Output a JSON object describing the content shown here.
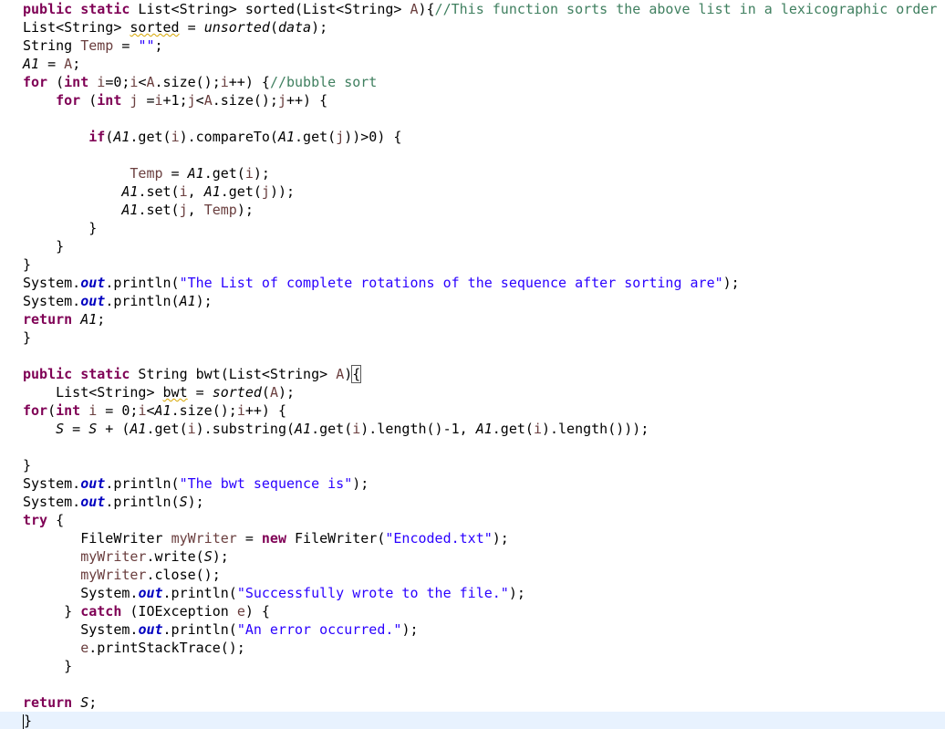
{
  "lines": [
    {
      "segments": [
        {
          "t": "public",
          "k": "kw"
        },
        {
          "t": " "
        },
        {
          "t": "static",
          "k": "kw"
        },
        {
          "t": " List<String> sorted(List<String> "
        },
        {
          "t": "A",
          "k": "lv"
        },
        {
          "t": "){"
        },
        {
          "t": "//This function sorts the above list in a lexicographic order",
          "k": "cm"
        }
      ]
    },
    {
      "segments": [
        {
          "t": "List<String> "
        },
        {
          "t": "sorted",
          "k": "warn"
        },
        {
          "t": " = "
        },
        {
          "t": "unsorted",
          "k": "it"
        },
        {
          "t": "("
        },
        {
          "t": "data",
          "k": "it"
        },
        {
          "t": ");"
        }
      ]
    },
    {
      "segments": [
        {
          "t": "String "
        },
        {
          "t": "Temp",
          "k": "lv"
        },
        {
          "t": " = "
        },
        {
          "t": "\"\"",
          "k": "st"
        },
        {
          "t": ";"
        }
      ]
    },
    {
      "segments": [
        {
          "t": "A1",
          "k": "it"
        },
        {
          "t": " = "
        },
        {
          "t": "A",
          "k": "lv"
        },
        {
          "t": ";"
        }
      ]
    },
    {
      "segments": [
        {
          "t": "for",
          "k": "kw"
        },
        {
          "t": " ("
        },
        {
          "t": "int",
          "k": "kw"
        },
        {
          "t": " "
        },
        {
          "t": "i",
          "k": "lv"
        },
        {
          "t": "=0;"
        },
        {
          "t": "i",
          "k": "lv"
        },
        {
          "t": "<"
        },
        {
          "t": "A",
          "k": "lv"
        },
        {
          "t": ".size();"
        },
        {
          "t": "i",
          "k": "lv"
        },
        {
          "t": "++) {"
        },
        {
          "t": "//bubble sort",
          "k": "cm"
        }
      ]
    },
    {
      "segments": [
        {
          "t": "    "
        },
        {
          "t": "for",
          "k": "kw"
        },
        {
          "t": " ("
        },
        {
          "t": "int",
          "k": "kw"
        },
        {
          "t": " "
        },
        {
          "t": "j",
          "k": "lv"
        },
        {
          "t": " ="
        },
        {
          "t": "i",
          "k": "lv"
        },
        {
          "t": "+1;"
        },
        {
          "t": "j",
          "k": "lv"
        },
        {
          "t": "<"
        },
        {
          "t": "A",
          "k": "lv"
        },
        {
          "t": ".size();"
        },
        {
          "t": "j",
          "k": "lv"
        },
        {
          "t": "++) {"
        }
      ]
    },
    {
      "segments": []
    },
    {
      "segments": [
        {
          "t": "        "
        },
        {
          "t": "if",
          "k": "kw"
        },
        {
          "t": "("
        },
        {
          "t": "A1",
          "k": "it"
        },
        {
          "t": ".get("
        },
        {
          "t": "i",
          "k": "lv"
        },
        {
          "t": ").compareTo("
        },
        {
          "t": "A1",
          "k": "it"
        },
        {
          "t": ".get("
        },
        {
          "t": "j",
          "k": "lv"
        },
        {
          "t": "))>0) {"
        }
      ]
    },
    {
      "segments": []
    },
    {
      "segments": [
        {
          "t": "             "
        },
        {
          "t": "Temp",
          "k": "lv"
        },
        {
          "t": " = "
        },
        {
          "t": "A1",
          "k": "it"
        },
        {
          "t": ".get("
        },
        {
          "t": "i",
          "k": "lv"
        },
        {
          "t": ");"
        }
      ]
    },
    {
      "segments": [
        {
          "t": "            "
        },
        {
          "t": "A1",
          "k": "it"
        },
        {
          "t": ".set("
        },
        {
          "t": "i",
          "k": "lv"
        },
        {
          "t": ", "
        },
        {
          "t": "A1",
          "k": "it"
        },
        {
          "t": ".get("
        },
        {
          "t": "j",
          "k": "lv"
        },
        {
          "t": "));"
        }
      ]
    },
    {
      "segments": [
        {
          "t": "            "
        },
        {
          "t": "A1",
          "k": "it"
        },
        {
          "t": ".set("
        },
        {
          "t": "j",
          "k": "lv"
        },
        {
          "t": ", "
        },
        {
          "t": "Temp",
          "k": "lv"
        },
        {
          "t": ");"
        }
      ]
    },
    {
      "segments": [
        {
          "t": "        }"
        }
      ]
    },
    {
      "segments": [
        {
          "t": "    }"
        }
      ]
    },
    {
      "segments": [
        {
          "t": "}"
        }
      ]
    },
    {
      "segments": [
        {
          "t": "System."
        },
        {
          "t": "out",
          "k": "fi"
        },
        {
          "t": ".println("
        },
        {
          "t": "\"The List of complete rotations of the sequence after sorting are\"",
          "k": "st"
        },
        {
          "t": ");"
        }
      ]
    },
    {
      "segments": [
        {
          "t": "System."
        },
        {
          "t": "out",
          "k": "fi"
        },
        {
          "t": ".println("
        },
        {
          "t": "A1",
          "k": "it"
        },
        {
          "t": ");"
        }
      ]
    },
    {
      "segments": [
        {
          "t": "return",
          "k": "kw"
        },
        {
          "t": " "
        },
        {
          "t": "A1",
          "k": "it"
        },
        {
          "t": ";"
        }
      ]
    },
    {
      "segments": [
        {
          "t": "}"
        }
      ]
    },
    {
      "segments": []
    },
    {
      "segments": [
        {
          "t": "public",
          "k": "kw"
        },
        {
          "t": " "
        },
        {
          "t": "static",
          "k": "kw"
        },
        {
          "t": " String bwt(List<String> "
        },
        {
          "t": "A",
          "k": "lv"
        },
        {
          "t": ")"
        },
        {
          "t": "{",
          "k": "bracket"
        }
      ]
    },
    {
      "segments": [
        {
          "t": "    List<String> "
        },
        {
          "t": "bwt",
          "k": "warn"
        },
        {
          "t": " = "
        },
        {
          "t": "sorted",
          "k": "it"
        },
        {
          "t": "("
        },
        {
          "t": "A",
          "k": "lv"
        },
        {
          "t": ");"
        }
      ]
    },
    {
      "segments": [
        {
          "t": "for",
          "k": "kw"
        },
        {
          "t": "("
        },
        {
          "t": "int",
          "k": "kw"
        },
        {
          "t": " "
        },
        {
          "t": "i",
          "k": "lv"
        },
        {
          "t": " = 0;"
        },
        {
          "t": "i",
          "k": "lv"
        },
        {
          "t": "<"
        },
        {
          "t": "A1",
          "k": "it"
        },
        {
          "t": ".size();"
        },
        {
          "t": "i",
          "k": "lv"
        },
        {
          "t": "++) {"
        }
      ]
    },
    {
      "segments": [
        {
          "t": "    "
        },
        {
          "t": "S",
          "k": "it"
        },
        {
          "t": " = "
        },
        {
          "t": "S",
          "k": "it"
        },
        {
          "t": " + ("
        },
        {
          "t": "A1",
          "k": "it"
        },
        {
          "t": ".get("
        },
        {
          "t": "i",
          "k": "lv"
        },
        {
          "t": ").substring("
        },
        {
          "t": "A1",
          "k": "it"
        },
        {
          "t": ".get("
        },
        {
          "t": "i",
          "k": "lv"
        },
        {
          "t": ").length()-1, "
        },
        {
          "t": "A1",
          "k": "it"
        },
        {
          "t": ".get("
        },
        {
          "t": "i",
          "k": "lv"
        },
        {
          "t": ").length()));"
        }
      ]
    },
    {
      "segments": []
    },
    {
      "segments": [
        {
          "t": "}"
        }
      ]
    },
    {
      "segments": [
        {
          "t": "System."
        },
        {
          "t": "out",
          "k": "fi"
        },
        {
          "t": ".println("
        },
        {
          "t": "\"The bwt sequence is\"",
          "k": "st"
        },
        {
          "t": ");"
        }
      ]
    },
    {
      "segments": [
        {
          "t": "System."
        },
        {
          "t": "out",
          "k": "fi"
        },
        {
          "t": ".println("
        },
        {
          "t": "S",
          "k": "it"
        },
        {
          "t": ");"
        }
      ]
    },
    {
      "segments": [
        {
          "t": "try",
          "k": "kw"
        },
        {
          "t": " {"
        }
      ]
    },
    {
      "segments": [
        {
          "t": "       FileWriter "
        },
        {
          "t": "myWriter",
          "k": "lv"
        },
        {
          "t": " = "
        },
        {
          "t": "new",
          "k": "kw"
        },
        {
          "t": " FileWriter("
        },
        {
          "t": "\"Encoded.txt\"",
          "k": "st"
        },
        {
          "t": ");"
        }
      ]
    },
    {
      "segments": [
        {
          "t": "       "
        },
        {
          "t": "myWriter",
          "k": "lv"
        },
        {
          "t": ".write("
        },
        {
          "t": "S",
          "k": "it"
        },
        {
          "t": ");"
        }
      ]
    },
    {
      "segments": [
        {
          "t": "       "
        },
        {
          "t": "myWriter",
          "k": "lv"
        },
        {
          "t": ".close();"
        }
      ]
    },
    {
      "segments": [
        {
          "t": "       System."
        },
        {
          "t": "out",
          "k": "fi"
        },
        {
          "t": ".println("
        },
        {
          "t": "\"Successfully wrote to the file.\"",
          "k": "st"
        },
        {
          "t": ");"
        }
      ]
    },
    {
      "segments": [
        {
          "t": "     } "
        },
        {
          "t": "catch",
          "k": "kw"
        },
        {
          "t": " (IOException "
        },
        {
          "t": "e",
          "k": "lv"
        },
        {
          "t": ") {"
        }
      ]
    },
    {
      "segments": [
        {
          "t": "       System."
        },
        {
          "t": "out",
          "k": "fi"
        },
        {
          "t": ".println("
        },
        {
          "t": "\"An error occurred.\"",
          "k": "st"
        },
        {
          "t": ");"
        }
      ]
    },
    {
      "segments": [
        {
          "t": "       "
        },
        {
          "t": "e",
          "k": "lv"
        },
        {
          "t": ".printStackTrace();"
        }
      ]
    },
    {
      "segments": [
        {
          "t": "     }"
        }
      ]
    },
    {
      "segments": []
    },
    {
      "segments": [
        {
          "t": "return",
          "k": "kw"
        },
        {
          "t": " "
        },
        {
          "t": "S",
          "k": "it"
        },
        {
          "t": ";"
        }
      ]
    },
    {
      "segments": [
        {
          "t": "}"
        }
      ]
    }
  ],
  "current_line": 39,
  "colors": {
    "keyword": "#7f0055",
    "comment": "#3f7f5f",
    "string": "#2a00ff",
    "static_field": "#0000c0",
    "local_variable": "#6a3e3e",
    "current_line_bg": "#e8f2fe"
  }
}
